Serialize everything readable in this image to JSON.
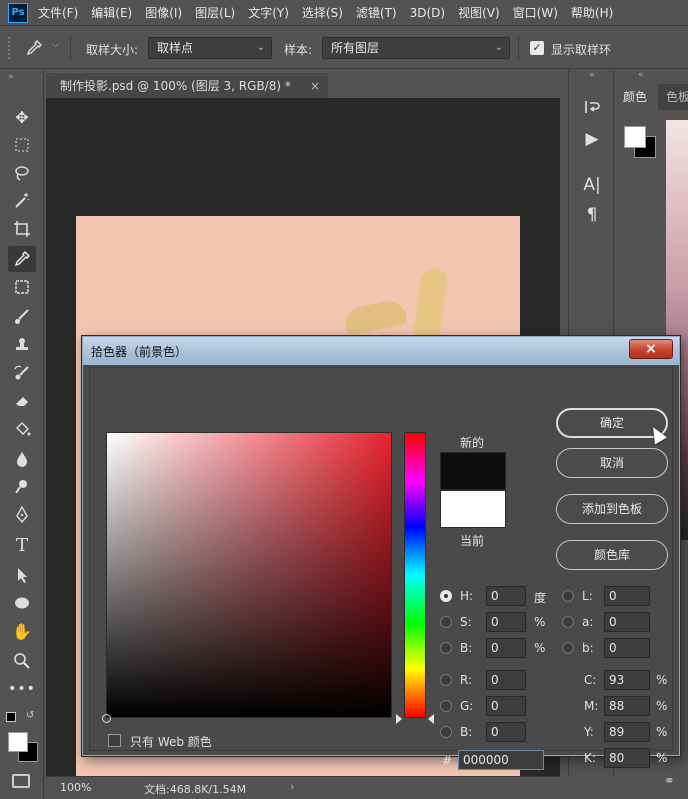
{
  "app": {
    "logo": "Ps"
  },
  "menu": [
    "文件(F)",
    "编辑(E)",
    "图像(I)",
    "图层(L)",
    "文字(Y)",
    "选择(S)",
    "滤镜(T)",
    "3D(D)",
    "视图(V)",
    "窗口(W)",
    "帮助(H)"
  ],
  "options": {
    "sample_size_label": "取样大小:",
    "sample_size_value": "取样点",
    "sample_label": "样本:",
    "sample_value": "所有图层",
    "show_ring_label": "显示取样环",
    "show_ring_checked": true
  },
  "toolbar": {
    "icons": [
      "move-icon",
      "marquee-icon",
      "lasso-icon",
      "magic-wand-icon",
      "crop-icon",
      "eyedropper-icon",
      "frame-icon",
      "brush-icon",
      "stamp-icon",
      "history-brush-icon",
      "eraser-icon",
      "paint-bucket-icon",
      "blur-icon",
      "dodge-icon",
      "pen-icon",
      "type-icon",
      "path-select-icon",
      "ellipse-icon",
      "hand-icon",
      "zoom-icon",
      "more-icon"
    ],
    "active": "eyedropper-icon"
  },
  "document": {
    "tab_title": "制作投影.psd @ 100% (图层 3, RGB/8) *",
    "zoom": "100%",
    "doc_size": "文档:468.8K/1.54M",
    "background_color": "#f2c5b1"
  },
  "right_panel": {
    "tab_color": "颜色",
    "tab_swatches": "色板",
    "icons": [
      "history-icon",
      "play-icon",
      "character-icon",
      "paragraph-icon"
    ]
  },
  "dialog": {
    "title": "拾色器（前景色）",
    "new_label": "新的",
    "current_label": "当前",
    "new_color": "#0c0c0c",
    "current_color": "#ffffff",
    "buttons": {
      "ok": "确定",
      "cancel": "取消",
      "add_swatch": "添加到色板",
      "color_library": "颜色库"
    },
    "fields": {
      "H": "0",
      "H_unit": "度",
      "S": "0",
      "S_unit": "%",
      "B": "0",
      "B_unit": "%",
      "R": "0",
      "G": "0",
      "B2": "0",
      "L": "0",
      "a": "0",
      "b": "0",
      "C": "93",
      "M": "88",
      "Y": "89",
      "K": "80",
      "CMYK_unit": "%",
      "hex": "000000"
    },
    "labels": {
      "H": "H:",
      "S": "S:",
      "B": "B:",
      "R": "R:",
      "G": "G:",
      "B2": "B:",
      "L": "L:",
      "a": "a:",
      "b": "b:",
      "C": "C:",
      "M": "M:",
      "Y": "Y:",
      "K": "K:",
      "hex": "#"
    },
    "selected_radio": "H",
    "web_only_label": "只有 Web 颜色",
    "web_only_checked": false
  }
}
